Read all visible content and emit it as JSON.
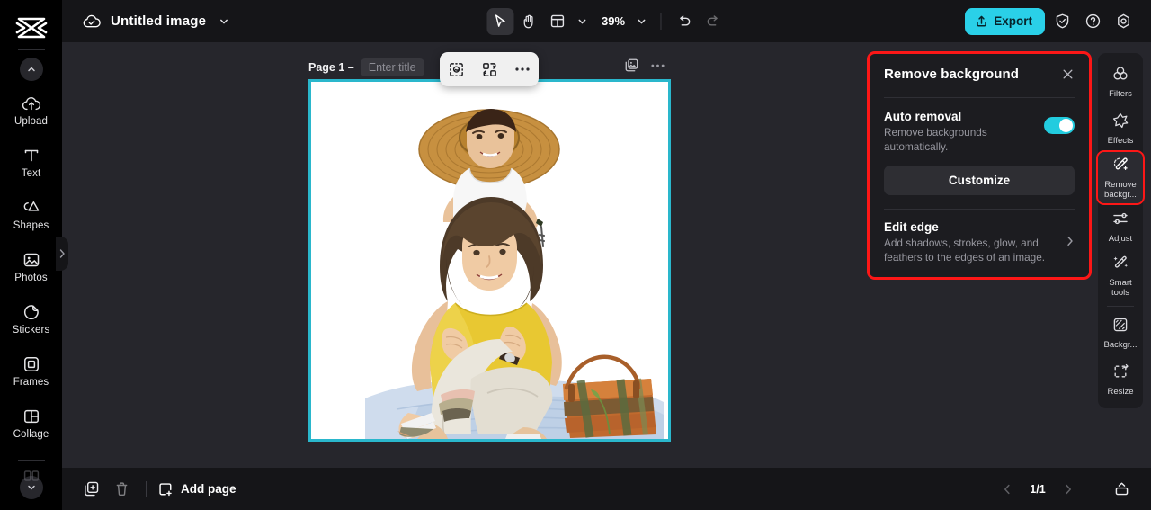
{
  "app": {
    "document_title": "Untitled image",
    "zoom_level": "39%",
    "export_label": "Export",
    "cloud_icon": "cloud-check-icon",
    "title_chevron_icon": "chevron-down-icon",
    "select_tool_icon": "cursor-arrow-icon",
    "hand_tool_icon": "hand-icon",
    "layout_tool_icon": "layout-panel-icon",
    "layout_chevron_icon": "chevron-down-icon",
    "zoom_chevron_icon": "chevron-down-icon",
    "undo_icon": "undo-arrow-icon",
    "redo_icon": "redo-arrow-icon",
    "export_icon": "upload-share-icon",
    "shield_icon": "shield-check-icon",
    "help_icon": "question-circle-icon",
    "settings_icon": "gear-hex-icon",
    "accent_color": "#2ad0e8",
    "highlight_color": "#fc1717",
    "panel_bg": "#1c1c20",
    "canvas_bg": "#26262c"
  },
  "left_sidebar": {
    "logo_icon": "capcut-logo-icon",
    "scroll_up_icon": "chevron-up-icon",
    "scroll_down_icon": "chevron-down-icon",
    "collapse_handle_icon": "chevron-right-icon",
    "items": [
      {
        "label": "Upload",
        "icon": "upload-cloud-icon"
      },
      {
        "label": "Text",
        "icon": "text-t-icon"
      },
      {
        "label": "Shapes",
        "icon": "shapes-icon"
      },
      {
        "label": "Photos",
        "icon": "photo-image-icon"
      },
      {
        "label": "Stickers",
        "icon": "sticker-icon"
      },
      {
        "label": "Frames",
        "icon": "frame-square-icon"
      },
      {
        "label": "Collage",
        "icon": "collage-grid-icon"
      }
    ]
  },
  "canvas": {
    "page_label": "Page 1 –",
    "title_placeholder": "Enter title",
    "duplicate_page_icon": "duplicate-image-icon",
    "page_more_icon": "more-horizontal-icon",
    "floating_toolbar": [
      {
        "icon": "cutout-select-icon",
        "name": "cutout-tool"
      },
      {
        "icon": "replace-swap-icon",
        "name": "replace-tool"
      },
      {
        "icon": "more-horizontal-icon",
        "name": "more-options"
      }
    ],
    "selection_color": "#2ab7cc",
    "image_alt": "Woman sitting with toddler wearing a large straw hat on her shoulders, beach bag and denim blanket, white background"
  },
  "remove_background_panel": {
    "title": "Remove background",
    "close_icon": "close-x-icon",
    "auto_removal": {
      "title": "Auto removal",
      "description": "Remove backgrounds automatically.",
      "toggle_on": true,
      "toggle_color": "#22ccdf"
    },
    "customize_label": "Customize",
    "edit_edge": {
      "title": "Edit edge",
      "description": "Add shadows, strokes, glow, and feathers to the edges of an image.",
      "chevron_icon": "chevron-right-icon"
    }
  },
  "right_toolbar": {
    "items": [
      {
        "label": "Filters",
        "icon": "filters-circles-icon",
        "selected": false
      },
      {
        "label": "Effects",
        "icon": "effects-star-icon",
        "selected": false
      },
      {
        "label": "Remove backgr...",
        "icon": "remove-background-wand-icon",
        "selected": true
      },
      {
        "label": "Adjust",
        "icon": "adjust-sliders-icon",
        "selected": false
      },
      {
        "label": "Smart tools",
        "icon": "smart-tools-wand-icon",
        "selected": false
      },
      {
        "label": "Backgr...",
        "icon": "background-hatch-icon",
        "selected": false
      },
      {
        "label": "Resize",
        "icon": "resize-frame-icon",
        "selected": false
      }
    ]
  },
  "bottom_bar": {
    "duplicate_icon": "duplicate-page-icon",
    "delete_icon": "trash-icon",
    "add_page_label": "Add page",
    "add_page_icon": "add-page-square-icon",
    "page_counter": "1/1",
    "prev_icon": "chevron-left-icon",
    "next_icon": "chevron-right-icon",
    "panel_toggle_icon": "bottom-panel-icon"
  }
}
